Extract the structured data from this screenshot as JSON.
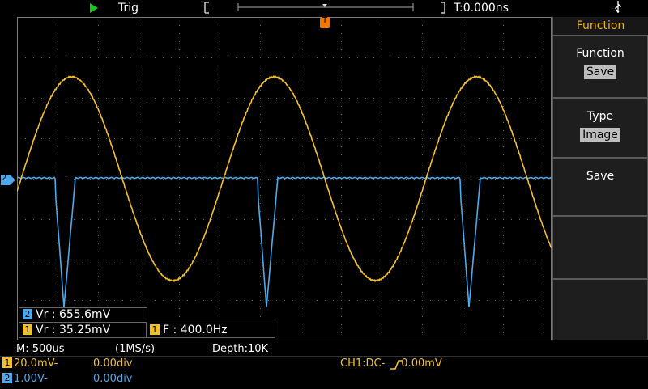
{
  "top": {
    "status": "Trig",
    "time_offset": "T:0.000ns",
    "trigger_marker": "T",
    "usb_icon": "usb-icon"
  },
  "channel_marker": "2",
  "menu": {
    "title": "Function",
    "items": [
      {
        "label": "Function",
        "value": "Save"
      },
      {
        "label": "Type",
        "value": "Image"
      },
      {
        "label": "Save",
        "value": ""
      },
      {
        "label": "",
        "value": ""
      },
      {
        "label": "",
        "value": ""
      }
    ]
  },
  "measurements": {
    "ch2_vr": {
      "ch": "2",
      "text": "Vr : 655.6mV"
    },
    "ch1_vr": {
      "ch": "1",
      "text": "Vr : 35.25mV"
    },
    "ch1_f": {
      "ch": "1",
      "text": "F : 400.0Hz"
    }
  },
  "timebase": {
    "m": "M: 500us",
    "rate": "(1MS/s)",
    "depth": "Depth:10K"
  },
  "channels": [
    {
      "num": "1",
      "scale": "20.0mV-",
      "offset": "0.00div",
      "color": "#f2c02c"
    },
    {
      "num": "2",
      "scale": "1.00V-",
      "offset": "0.00div",
      "color": "#4ea8ec"
    }
  ],
  "trigger_info": "CH1:DC-  0.00mV",
  "colors": {
    "ch1": "#f2c02c",
    "ch2": "#4ea8ec",
    "menu_accent": "#f2b500",
    "run": "#19c619"
  }
}
